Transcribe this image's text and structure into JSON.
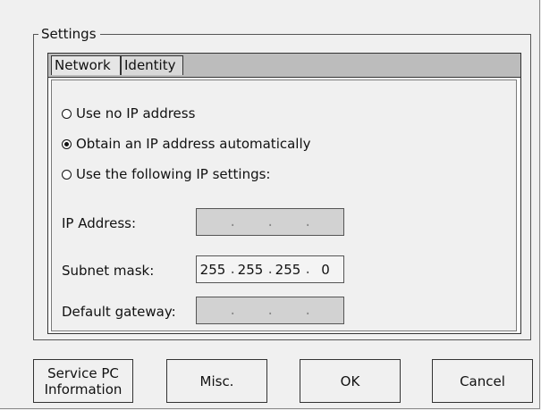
{
  "settings": {
    "group_title": "Settings",
    "tabs": [
      {
        "label": "Network",
        "selected": true
      },
      {
        "label": "Identity",
        "selected": false
      }
    ],
    "network": {
      "radios": [
        {
          "label": "Use no IP address",
          "checked": false
        },
        {
          "label": "Obtain an IP address automatically",
          "checked": true
        },
        {
          "label": "Use the following IP settings:",
          "checked": false
        }
      ],
      "fields": [
        {
          "label": "IP Address:",
          "octets": [
            "",
            "",
            "",
            ""
          ],
          "enabled": false
        },
        {
          "label": "Subnet mask:",
          "octets": [
            "255",
            "255",
            "255",
            "0"
          ],
          "enabled": true
        },
        {
          "label": "Default gateway:",
          "octets": [
            "",
            "",
            "",
            ""
          ],
          "enabled": false
        }
      ]
    }
  },
  "buttons": {
    "service_pc_line1": "Service PC",
    "service_pc_line2": "Information",
    "misc": "Misc.",
    "ok": "OK",
    "cancel": "Cancel"
  }
}
